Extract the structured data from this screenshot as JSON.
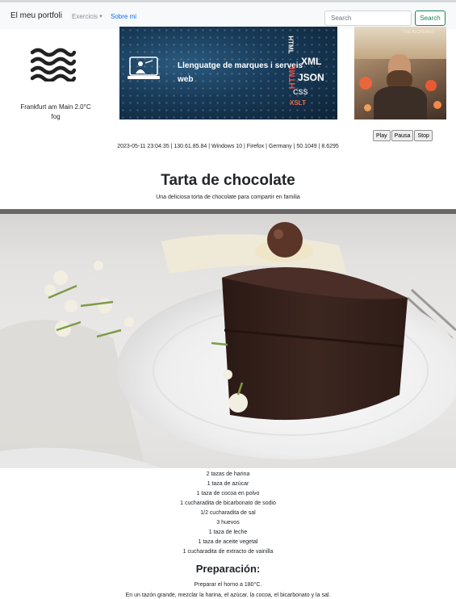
{
  "navbar": {
    "brand": "El meu portfoli",
    "dropdown_label": "Exercicis",
    "link_label": "Sobre mi",
    "search_placeholder": "Search",
    "search_button": "Search"
  },
  "weather": {
    "icon": "fog-icon",
    "city_temp": "Frankfurt am Main 2.0°C",
    "description": "fog"
  },
  "banner": {
    "title": "Llenguatge de marques i serveis web",
    "tags": [
      "XML",
      "JSON",
      "HTML",
      "CSS",
      "XSLT",
      "HTML"
    ]
  },
  "painting": {
    "caption": "THE ALCHEMIST"
  },
  "media": {
    "play": "Play",
    "pause": "Pausa",
    "stop": "Stop"
  },
  "visitor_info": "2023-05-11 23:04:35 | 130.61.85.84 | Windows 10 | Firefox | Germany | 50.1049 | 8.6295",
  "recipe": {
    "title": "Tarta de chocolate",
    "subtitle": "Una deliciosa torta de chocolate para compartir en familia",
    "ingredients": [
      "2 tazas de harina",
      "1 taza de azúcar",
      "1 taza de cocoa en polvo",
      "1 cucharadita de bicarbonato de sodio",
      "1/2 cucharadita de sal",
      "3 huevos",
      "1 taza de leche",
      "1 taza de aceite vegetal",
      "1 cucharadita de extracto de vainilla"
    ],
    "preparation_heading": "Preparación:",
    "steps": [
      "Preparar el horno a 180°C.",
      "En un tazón grande, mezclar la harina, el azúcar, la cocoa, el bicarbonato y la sal."
    ]
  },
  "colors": {
    "navbar_bg": "#f8f9fa",
    "link": "#0d6efd",
    "search_button": "#198754",
    "banner_bg": "#183a58",
    "cake": "#3a2520",
    "plate": "#f4f4f4"
  }
}
